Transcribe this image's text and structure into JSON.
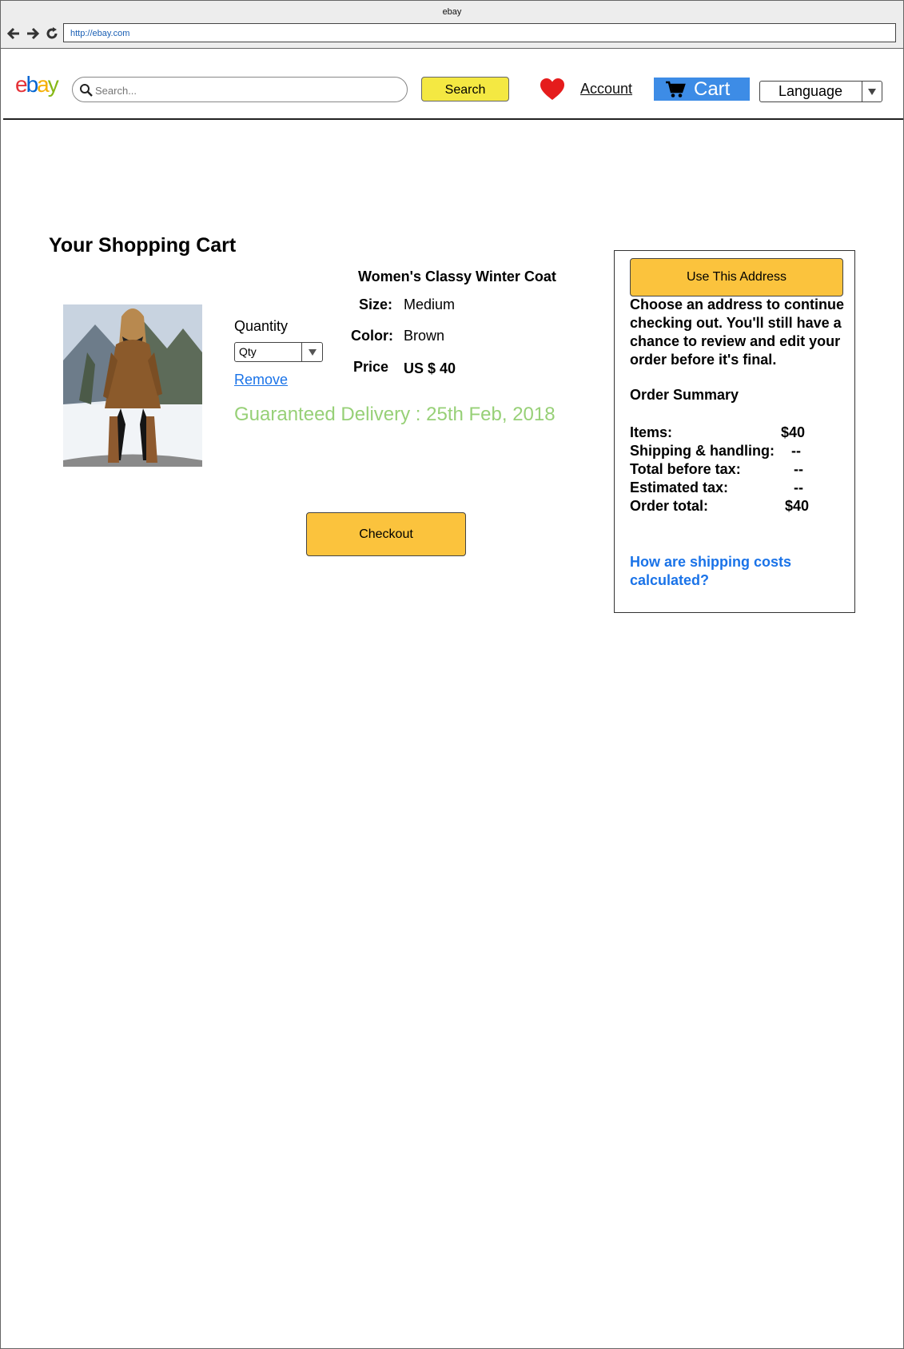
{
  "browser": {
    "title": "ebay",
    "url": "http://ebay.com"
  },
  "header": {
    "logo": {
      "e": "e",
      "b": "b",
      "a": "a",
      "y": "y"
    },
    "search_placeholder": "Search...",
    "search_button": "Search",
    "account": "Account",
    "cart": "Cart",
    "language": "Language"
  },
  "cart": {
    "title": "Your Shopping Cart",
    "product": {
      "name": "Women's Classy Winter Coat",
      "size_label": "Size:",
      "size": "Medium",
      "color_label": "Color:",
      "color": "Brown",
      "price_label": "Price",
      "price": "US $ 40"
    },
    "quantity_label": "Quantity",
    "qty_select": "Qty",
    "remove": "Remove",
    "delivery": "Guaranteed Delivery : 25th Feb, 2018",
    "checkout": "Checkout"
  },
  "summary": {
    "use_address": "Use This Address",
    "address_text": "Choose an address to continue checking out. You'll still have a chance to review and edit your order before it's final.",
    "title": "Order Summary",
    "rows": [
      {
        "label": "Items:",
        "value": "$40"
      },
      {
        "label": "Shipping & handling:",
        "value": "--"
      },
      {
        "label": "Total before tax:",
        "value": "--"
      },
      {
        "label": "Estimated tax:",
        "value": "--"
      },
      {
        "label": "Order total:",
        "value": "$40"
      }
    ],
    "shipping_link": "How are shipping costs calculated?"
  },
  "colors": {
    "search_button": "#f4e842",
    "cart_button": "#3d8ce6",
    "checkout_button": "#fbc33d",
    "delivery_text": "#97d077",
    "link": "#1a73e8",
    "heart": "#e51c1c"
  },
  "icons": [
    "back-arrow-icon",
    "forward-arrow-icon",
    "reload-icon",
    "search-icon",
    "heart-icon",
    "shopping-cart-icon",
    "chevron-down-icon"
  ]
}
